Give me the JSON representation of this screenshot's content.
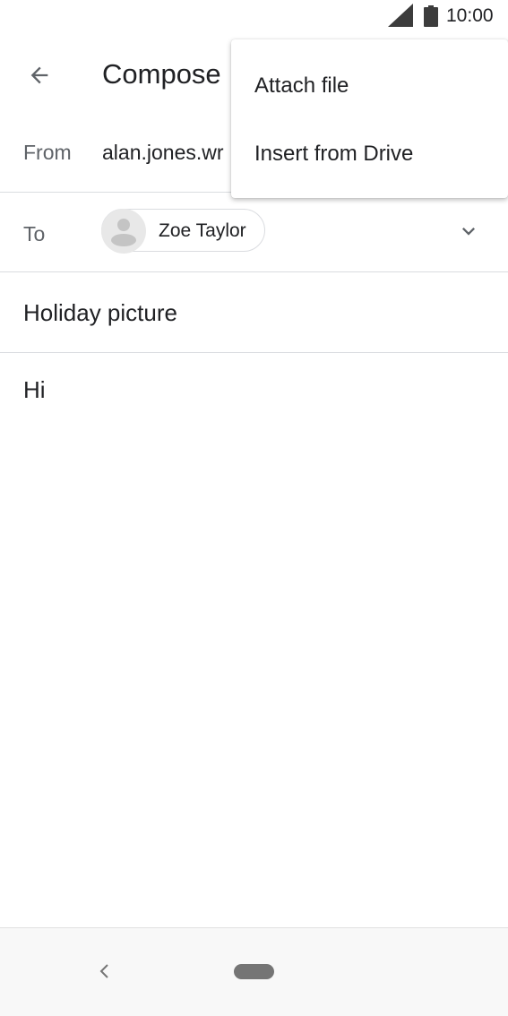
{
  "status_bar": {
    "time": "10:00",
    "signal_icon": "cellular-signal-icon",
    "battery_icon": "battery-icon"
  },
  "app_bar": {
    "back_icon": "arrow-back-icon",
    "title": "Compose"
  },
  "from": {
    "label": "From",
    "value": "alan.jones.wr"
  },
  "to": {
    "label": "To",
    "recipients": [
      {
        "name": "Zoe Taylor",
        "avatar_icon": "person-avatar-icon"
      }
    ],
    "expand_icon": "chevron-down-icon"
  },
  "subject": {
    "value": "Holiday picture"
  },
  "body": {
    "value": "Hi"
  },
  "overflow_menu": {
    "items": [
      {
        "label": "Attach file"
      },
      {
        "label": "Insert from Drive"
      }
    ]
  },
  "nav_bar": {
    "back_icon": "nav-back-icon",
    "home_icon": "nav-home-pill-icon"
  },
  "colors": {
    "text_primary": "#202124",
    "text_secondary": "#5f6368",
    "divider": "#dadce0",
    "nav_background": "#f8f8f8"
  }
}
